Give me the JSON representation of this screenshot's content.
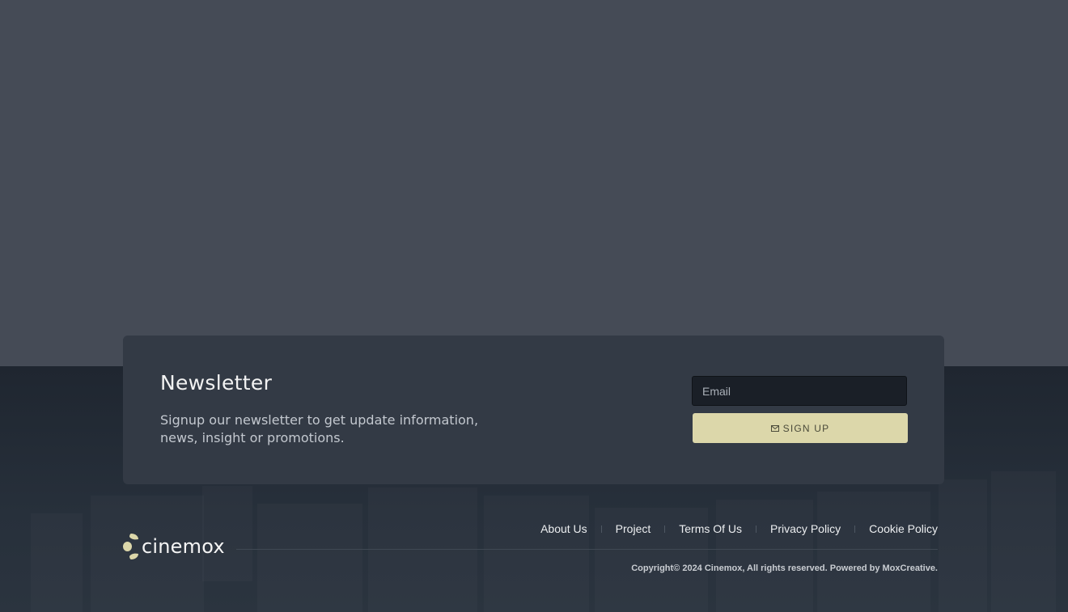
{
  "newsletter": {
    "title": "Newsletter",
    "description": "Signup our newsletter to get update information, news, insight or promotions.",
    "email_placeholder": "Email",
    "signup_label": "SIGN UP"
  },
  "brand": {
    "name": "cinemox",
    "accent_color": "#dcd7aa",
    "logo_icon": "cinemox-logo-mark-icon"
  },
  "footer": {
    "links": [
      {
        "label": "About Us"
      },
      {
        "label": "Project"
      },
      {
        "label": "Terms Of Us"
      },
      {
        "label": "Privacy Policy"
      },
      {
        "label": "Cookie Policy"
      }
    ],
    "copyright": "Copyright© 2024 Cinemox, All rights reserved. Powered by MoxCreative."
  },
  "colors": {
    "page_background": "#454b56",
    "footer_background": "#1f2630",
    "card_background": "#333a45",
    "input_background": "#1a1f27"
  }
}
